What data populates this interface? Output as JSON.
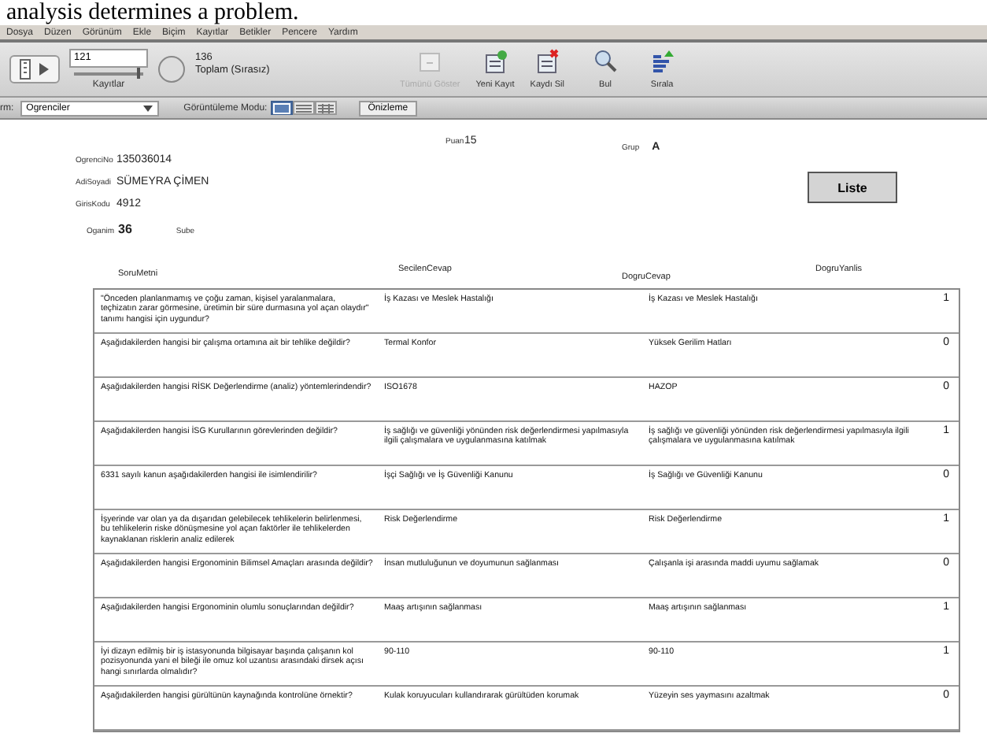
{
  "caption": "analysis determines a problem.",
  "menu": [
    "Dosya",
    "Düzen",
    "Görünüm",
    "Ekle",
    "Biçim",
    "Kayıtlar",
    "Betikler",
    "Pencere",
    "Yardım"
  ],
  "toolbar": {
    "record": "121",
    "slider": {
      "level": 0.9
    },
    "records_label": "Kayıtlar",
    "total": "136",
    "total_label": "Toplam (Sırasız)",
    "buttons": [
      {
        "kind": "show-all",
        "label": "Tümünü Göster",
        "disabled": true
      },
      {
        "kind": "new",
        "label": "Yeni Kayıt",
        "disabled": false
      },
      {
        "kind": "delete",
        "label": "Kaydı Sil",
        "disabled": false
      },
      {
        "kind": "find",
        "label": "Bul",
        "disabled": false
      },
      {
        "kind": "sort",
        "label": "Sırala",
        "disabled": false
      }
    ]
  },
  "layout_bar": {
    "label": "rm:",
    "layout": "Ogrenciler",
    "view_label": "Görüntüleme Modu:",
    "view_modes": [
      {
        "kind": "form",
        "selected": true
      },
      {
        "kind": "list",
        "selected": false
      },
      {
        "kind": "table",
        "selected": false
      }
    ],
    "preview": "Önizleme"
  },
  "form": {
    "fields": [
      {
        "label": "OgrenciNo",
        "value": "135036014"
      },
      {
        "label": "AdiSoyadi",
        "value": "SÜMEYRA ÇİMEN"
      },
      {
        "label": "GirisKodu",
        "value": "4912"
      }
    ],
    "ogrenim": {
      "label": "Oganim",
      "value": "36"
    },
    "sube": {
      "label": "Sube"
    },
    "puan": {
      "label": "Puan",
      "value": "15"
    },
    "grup": {
      "label": "Grup",
      "value": "A"
    },
    "button": "Liste"
  },
  "table": {
    "columns": [
      "SoruMetni",
      "SecilenCevap",
      "DogruCevap",
      "DogruYanlis"
    ],
    "rows": [
      [
        "\"Önceden planlanmamış ve çoğu zaman, kişisel yaralanmalara, teçhizatın zarar görmesine, üretimin bir süre durmasına yol açan olaydır\" tanımı hangisi için uygundur?",
        "İş Kazası ve Meslek Hastalığı",
        "İş Kazası ve Meslek Hastalığı",
        "1"
      ],
      [
        "Aşağıdakilerden hangisi bir çalışma ortamına ait bir tehlike değildir?",
        "Termal Konfor",
        "Yüksek Gerilim Hatları",
        "0"
      ],
      [
        "Aşağıdakilerden hangisi RİSK Değerlendirme (analiz) yöntemlerindendir?",
        "ISO1678",
        "HAZOP",
        "0"
      ],
      [
        "Aşağıdakilerden hangisi İSG Kurullarının görevlerinden değildir?",
        "İş sağlığı ve güvenliği yönünden risk değerlendirmesi yapılmasıyla ilgili çalışmalara ve uygulanmasına katılmak",
        "İş sağlığı ve güvenliği yönünden risk değerlendirmesi yapılmasıyla ilgili çalışmalara ve uygulanmasına katılmak",
        "1"
      ],
      [
        "6331 sayılı kanun aşağıdakilerden hangisi ile isimlendirilir?",
        "İşçi Sağlığı ve İş Güvenliği Kanunu",
        "İş Sağlığı ve Güvenliği Kanunu",
        "0"
      ],
      [
        "İşyerinde var olan ya da dışarıdan gelebilecek tehlikelerin belirlenmesi, bu tehlikelerin riske dönüşmesine yol açan faktörler ile tehlikelerden kaynaklanan risklerin analiz edilerek",
        "Risk Değerlendirme",
        "Risk Değerlendirme",
        "1"
      ],
      [
        "Aşağıdakilerden hangisi Ergonominin Bilimsel Amaçları arasında değildir?",
        "İnsan mutluluğunun ve doyumunun sağlanması",
        "Çalışanla işi arasında maddi uyumu sağlamak",
        "0"
      ],
      [
        "Aşağıdakilerden hangisi Ergonominin olumlu sonuçlarından değildir?",
        "Maaş artışının sağlanması",
        "Maaş artışının sağlanması",
        "1"
      ],
      [
        "İyi dizayn edilmiş bir iş istasyonunda bilgisayar başında çalışanın kol pozisyonunda yani el bileği ile omuz kol uzantısı arasındaki dirsek açısı hangi sınırlarda olmalıdır?",
        "90-110",
        "90-110",
        "1"
      ],
      [
        "Aşağıdakilerden hangisi gürültünün kaynağında kontrolüne örnektir?",
        "Kulak koruyucuları kullandırarak gürültüden korumak",
        "Yüzeyin ses yaymasını azaltmak",
        "0"
      ]
    ]
  }
}
